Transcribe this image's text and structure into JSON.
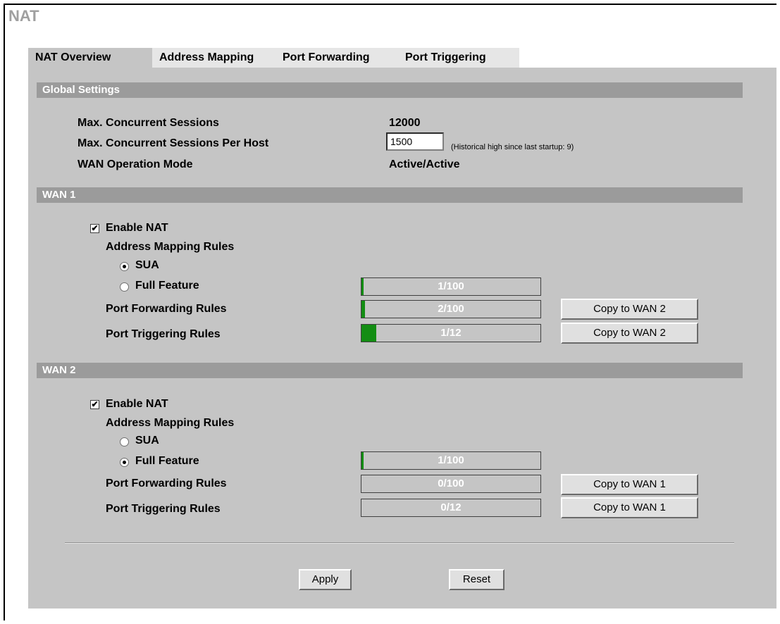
{
  "page": {
    "title": "NAT"
  },
  "tabs": [
    {
      "label": "NAT Overview",
      "active": true
    },
    {
      "label": "Address Mapping",
      "active": false
    },
    {
      "label": "Port Forwarding",
      "active": false
    },
    {
      "label": "Port Triggering",
      "active": false
    }
  ],
  "global": {
    "section_title": "Global Settings",
    "max_sessions_label": "Max. Concurrent Sessions",
    "max_sessions_value": "12000",
    "per_host_label": "Max. Concurrent Sessions Per Host",
    "per_host_value": "1500",
    "per_host_note": "(Historical high since last startup: 9)",
    "wan_mode_label": "WAN Operation Mode",
    "wan_mode_value": "Active/Active"
  },
  "wan1": {
    "section_title": "WAN 1",
    "enable_nat_label": "Enable NAT",
    "enable_nat_checked": true,
    "address_mapping_label": "Address Mapping Rules",
    "sua_label": "SUA",
    "full_feature_label": "Full Feature",
    "selected_mode": "SUA",
    "full_feature_usage": {
      "text": "1/100",
      "used": 1,
      "max": 100
    },
    "port_forwarding_label": "Port Forwarding Rules",
    "port_forwarding_usage": {
      "text": "2/100",
      "used": 2,
      "max": 100
    },
    "port_triggering_label": "Port Triggering Rules",
    "port_triggering_usage": {
      "text": "1/12",
      "used": 1,
      "max": 12
    },
    "copy_button_label": "Copy to WAN 2"
  },
  "wan2": {
    "section_title": "WAN 2",
    "enable_nat_label": "Enable NAT",
    "enable_nat_checked": true,
    "address_mapping_label": "Address Mapping Rules",
    "sua_label": "SUA",
    "full_feature_label": "Full Feature",
    "selected_mode": "Full Feature",
    "full_feature_usage": {
      "text": "1/100",
      "used": 1,
      "max": 100
    },
    "port_forwarding_label": "Port Forwarding Rules",
    "port_forwarding_usage": {
      "text": "0/100",
      "used": 0,
      "max": 100
    },
    "port_triggering_label": "Port Triggering Rules",
    "port_triggering_usage": {
      "text": "0/12",
      "used": 0,
      "max": 12
    },
    "copy_button_label": "Copy to WAN 1"
  },
  "actions": {
    "apply_label": "Apply",
    "reset_label": "Reset"
  },
  "colors": {
    "panel": "#c5c5c5",
    "section_bar": "#9b9b9b",
    "usage_fill": "#138d13",
    "title": "#a0a0a0"
  }
}
